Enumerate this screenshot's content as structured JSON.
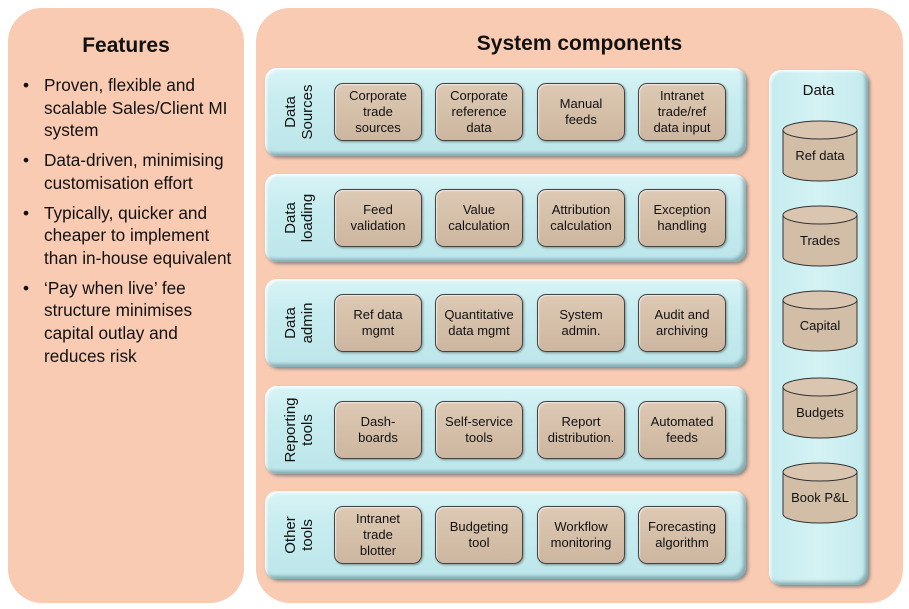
{
  "features": {
    "title": "Features",
    "bullet_glyph": "•",
    "items": [
      "Proven, flexible and scalable Sales/Client MI system",
      "Data-driven, minimising customisation effort",
      "Typically, quicker and cheaper to implement than in-house equivalent",
      "‘Pay when live’ fee structure minimises capital outlay and reduces risk"
    ]
  },
  "components": {
    "title": "System components",
    "rows": [
      {
        "label": "Data\nSources",
        "boxes": [
          "Corporate\ntrade\nsources",
          "Corporate\nreference\ndata",
          "Manual\nfeeds",
          "Intranet\ntrade/ref\ndata input"
        ]
      },
      {
        "label": "Data\nloading",
        "boxes": [
          "Feed\nvalidation",
          "Value\ncalculation",
          "Attribution\ncalculation",
          "Exception\nhandling"
        ]
      },
      {
        "label": "Data\nadmin",
        "boxes": [
          "Ref data\nmgmt",
          "Quantitative\ndata mgmt",
          "System\nadmin.",
          "Audit and\narchiving"
        ]
      },
      {
        "label": "Reporting\ntools",
        "boxes": [
          "Dash-\nboards",
          "Self-service\ntools",
          "Report\ndistribution.",
          "Automated\nfeeds"
        ]
      },
      {
        "label": "Other\ntools",
        "boxes": [
          "Intranet\ntrade\nblotter",
          "Budgeting\ntool",
          "Workflow\nmonitoring",
          "Forecasting\nalgorithm"
        ]
      }
    ],
    "data_store": {
      "title": "Data",
      "stores": [
        "Ref data",
        "Trades",
        "Capital",
        "Budgets",
        "Book P&L"
      ]
    }
  },
  "colors": {
    "panel": "#f9cbb3",
    "row": "#c6ecef",
    "box": "#d4bfa9"
  }
}
